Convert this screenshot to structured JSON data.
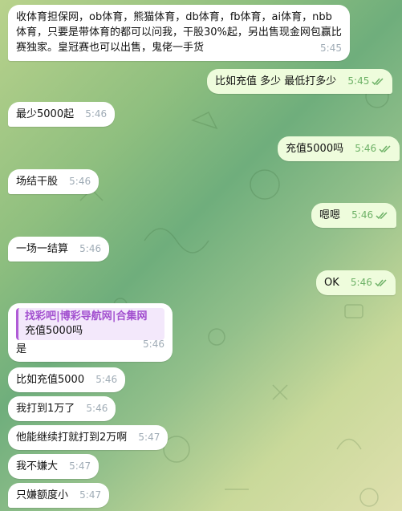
{
  "colors": {
    "incoming_bubble": "#ffffff",
    "outgoing_bubble": "#eefcdc",
    "outgoing_time": "#6db166",
    "incoming_time": "#a0acb6",
    "quote_accent": "#b05bd6"
  },
  "messages": [
    {
      "side": "in",
      "text": "收体育担保网，ob体育，熊猫体育，db体育，fb体育，ai体育，nbb体育，只要是带体育的都可以问我，干股30%起，另出售现金网包赢比赛独家。皇冠赛也可以出售，鬼佬一手货",
      "time": "5:45"
    },
    {
      "side": "out",
      "text": "比如充值 多少 最低打多少",
      "time": "5:45",
      "status_icon": "double-check-icon"
    },
    {
      "side": "in",
      "text": "最少5000起",
      "time": "5:46"
    },
    {
      "side": "out",
      "text": "充值5000吗",
      "time": "5:46",
      "status_icon": "double-check-icon"
    },
    {
      "side": "in",
      "text": "场结干股",
      "time": "5:46"
    },
    {
      "side": "out",
      "text": "嗯嗯",
      "time": "5:46",
      "status_icon": "double-check-icon"
    },
    {
      "side": "in",
      "text": "一场一结算",
      "time": "5:46"
    },
    {
      "side": "out",
      "text": "OK",
      "time": "5:46",
      "status_icon": "double-check-icon"
    },
    {
      "side": "in",
      "quote_title": "找彩吧|博彩导航网|合集网",
      "quote_text": "充值5000吗",
      "text": "是",
      "time": "5:46"
    },
    {
      "side": "in",
      "text": "比如充值5000",
      "time": "5:46"
    },
    {
      "side": "in",
      "text": "我打到1万了",
      "time": "5:46"
    },
    {
      "side": "in",
      "text": "他能继续打就打到2万啊",
      "time": "5:47"
    },
    {
      "side": "in",
      "text": "我不嫌大",
      "time": "5:47"
    },
    {
      "side": "in",
      "text": "只嫌额度小",
      "time": "5:47"
    }
  ]
}
